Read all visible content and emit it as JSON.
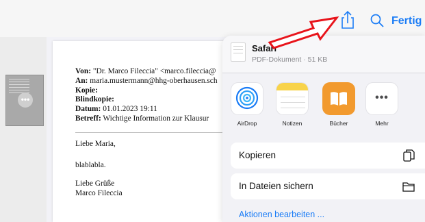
{
  "toolbar": {
    "done_label": "Fertig",
    "share_icon": "share-icon",
    "search_icon": "search-icon",
    "accent_color": "#1a7cf6"
  },
  "document": {
    "header_lines": [
      {
        "label": "Von:",
        "value": " \"Dr. Marco Fileccia\" <marco.fileccia@"
      },
      {
        "label": "An:",
        "value": " maria.mustermann@hhg-oberhausen.sch"
      },
      {
        "label": "Kopie:",
        "value": ""
      },
      {
        "label": "Blindkopie:",
        "value": ""
      },
      {
        "label": "Datum:",
        "value": " 01.01.2023 19:11"
      },
      {
        "label": "Betreff:",
        "value": " Wichtige Information zur Klausur"
      }
    ],
    "greeting": "Liebe Maria,",
    "body": "blablabla.",
    "closing": "Liebe Grüße",
    "signature": "Marco Fileccia"
  },
  "share_sheet": {
    "file_name": "Safari",
    "file_meta": "PDF-Dokument · 51 KB",
    "apps": [
      {
        "label": "AirDrop",
        "icon": "airdrop-icon"
      },
      {
        "label": "Notizen",
        "icon": "notes-icon"
      },
      {
        "label": "Bücher",
        "icon": "books-icon"
      },
      {
        "label": "Mehr",
        "icon": "more-icon"
      }
    ],
    "actions": [
      {
        "label": "Kopieren",
        "icon": "copy-icon"
      },
      {
        "label": "In Dateien sichern",
        "icon": "folder-icon"
      }
    ],
    "edit_actions_label": "Aktionen bearbeiten ..."
  },
  "annotation": {
    "arrow_color": "#e8141b"
  }
}
